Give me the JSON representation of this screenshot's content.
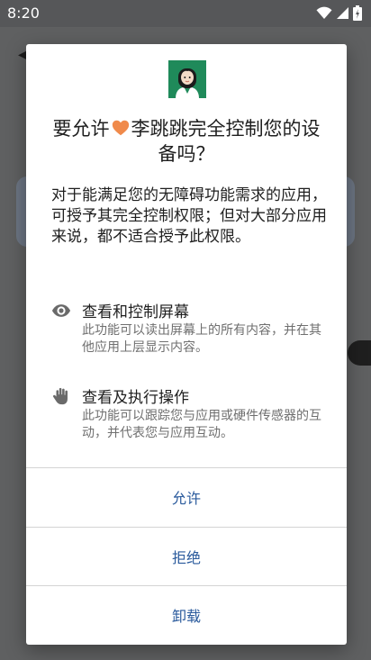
{
  "status_bar": {
    "time": "8:20"
  },
  "dialog": {
    "title_before": "要允许",
    "title_after": "李跳跳完全控制您的设备吗？",
    "description": "对于能满足您的无障碍功能需求的应用，可授予其完全控制权限；但对大部分应用来说，都不适合授予此权限。",
    "permissions": [
      {
        "icon": "eye-icon",
        "title": "查看和控制屏幕",
        "desc": "此功能可以读出屏幕上的所有内容，并在其他应用上层显示内容。"
      },
      {
        "icon": "hand-icon",
        "title": "查看及执行操作",
        "desc": "此功能可以跟踪您与应用或硬件传感器的互动，并代表您与应用互动。"
      }
    ],
    "actions": {
      "allow": "允许",
      "deny": "拒绝",
      "uninstall": "卸载"
    }
  },
  "colors": {
    "action": "#2a5a9c",
    "heart": "#f08a4b",
    "scrim": "#5f6061"
  }
}
